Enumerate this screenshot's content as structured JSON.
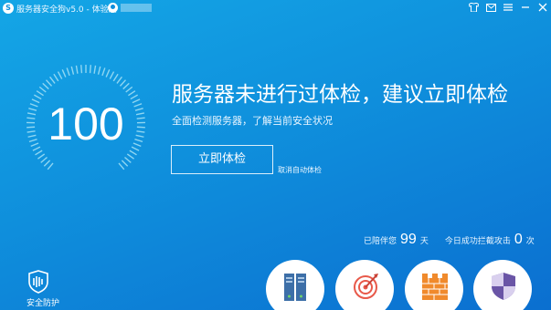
{
  "window": {
    "title": "服务器安全狗v5.0 - 体验版",
    "logo_glyph": "S"
  },
  "gauge": {
    "score": "100",
    "color": "#8fd6f2"
  },
  "main": {
    "headline": "服务器未进行过体检，建议立即体检",
    "subline": "全面检测服务器，了解当前安全状况",
    "check_button": "立即体检",
    "cancel_auto": "取消自动体检"
  },
  "stats": {
    "days_label": "已陪伴您",
    "days_value": "99",
    "days_unit": "天",
    "blocked_label": "今日成功拦截攻击",
    "blocked_value": "0",
    "blocked_unit": "次"
  },
  "bottom": {
    "security_label": "安全防护",
    "features": [
      "server-icon",
      "target-icon",
      "firewall-icon",
      "shield-icon"
    ]
  },
  "colors": {
    "accent": "#0f8fdc",
    "red": "#e8594a",
    "purple": "#6a55a6",
    "orange": "#f08a2c"
  }
}
